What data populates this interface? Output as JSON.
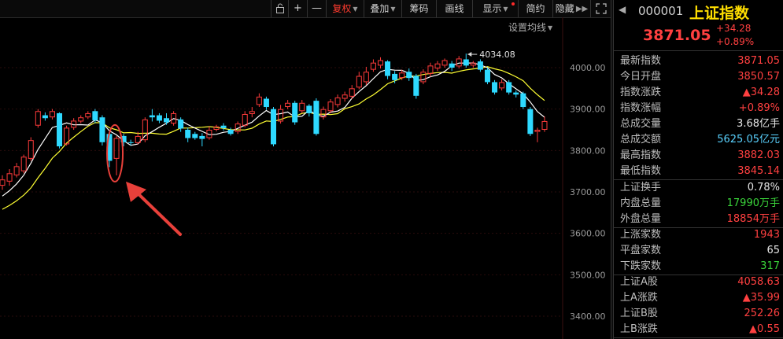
{
  "toolbar": {
    "lock_icon": "lock-icon",
    "plus": "+",
    "minus": "—",
    "items": [
      "复权",
      "叠加",
      "筹码",
      "画线",
      "显示",
      "简约",
      "隐藏"
    ],
    "active_color": "#ff3b2f",
    "ma_setting": "设置均线"
  },
  "panel": {
    "code": "000001",
    "name": "上证指数",
    "price": "3871.05",
    "change": "+34.28",
    "change_pct": "+0.89%",
    "group1": [
      {
        "label": "最新指数",
        "value": "3871.05",
        "color": "red"
      },
      {
        "label": "今日开盘",
        "value": "3850.57",
        "color": "red"
      },
      {
        "label": "指数涨跌",
        "value": "▲34.28",
        "color": "red"
      },
      {
        "label": "指数涨幅",
        "value": "+0.89%",
        "color": "red"
      },
      {
        "label": "总成交量",
        "value": "3.68亿手",
        "color": "white"
      },
      {
        "label": "总成交额",
        "value": "5625.05亿元",
        "color": "cyan"
      },
      {
        "label": "最高指数",
        "value": "3882.03",
        "color": "red"
      },
      {
        "label": "最低指数",
        "value": "3845.14",
        "color": "red"
      }
    ],
    "group2": [
      {
        "label": "上证换手",
        "value": "0.78%",
        "color": "white"
      },
      {
        "label": "内盘总量",
        "value": "17990万手",
        "color": "green"
      },
      {
        "label": "外盘总量",
        "value": "18854万手",
        "color": "red"
      }
    ],
    "group3": [
      {
        "label": "上涨家数",
        "value": "1943",
        "color": "red"
      },
      {
        "label": "平盘家数",
        "value": "65",
        "color": "white"
      },
      {
        "label": "下跌家数",
        "value": "317",
        "color": "green"
      }
    ],
    "group4": [
      {
        "label": "上证A股",
        "value": "4058.63",
        "color": "red"
      },
      {
        "label": "上A涨跌",
        "value": "▲35.99",
        "color": "red"
      },
      {
        "label": "上证B股",
        "value": "252.26",
        "color": "red"
      },
      {
        "label": "上B涨跌",
        "value": "▲0.55",
        "color": "red"
      }
    ]
  },
  "chart_data": {
    "type": "candlestick",
    "ylim": [
      3350,
      4100
    ],
    "yticks": [
      "4000.00",
      "3900.00",
      "3800.00",
      "3700.00",
      "3600.00",
      "3500.00",
      "3400.00"
    ],
    "ytick_values": [
      4000,
      3900,
      3800,
      3700,
      3600,
      3500,
      3400
    ],
    "max_label": "4034.08",
    "max_value": 4034.08,
    "up_color": "#ff3b3b",
    "down_color": "#2ed9ff",
    "ma5_color": "#ffffff",
    "ma10_color": "#ffff33",
    "candles": [
      {
        "o": 3715,
        "c": 3730,
        "h": 3740,
        "l": 3705
      },
      {
        "o": 3725,
        "c": 3745,
        "h": 3755,
        "l": 3715
      },
      {
        "o": 3740,
        "c": 3762,
        "h": 3770,
        "l": 3735
      },
      {
        "o": 3750,
        "c": 3785,
        "h": 3790,
        "l": 3745
      },
      {
        "o": 3780,
        "c": 3825,
        "h": 3832,
        "l": 3775
      },
      {
        "o": 3860,
        "c": 3895,
        "h": 3900,
        "l": 3855
      },
      {
        "o": 3885,
        "c": 3878,
        "h": 3892,
        "l": 3872
      },
      {
        "o": 3880,
        "c": 3895,
        "h": 3900,
        "l": 3875
      },
      {
        "o": 3890,
        "c": 3810,
        "h": 3892,
        "l": 3805
      },
      {
        "o": 3815,
        "c": 3855,
        "h": 3860,
        "l": 3812
      },
      {
        "o": 3855,
        "c": 3872,
        "h": 3878,
        "l": 3850
      },
      {
        "o": 3870,
        "c": 3880,
        "h": 3885,
        "l": 3866
      },
      {
        "o": 3880,
        "c": 3890,
        "h": 3895,
        "l": 3876
      },
      {
        "o": 3895,
        "c": 3873,
        "h": 3900,
        "l": 3866
      },
      {
        "o": 3880,
        "c": 3820,
        "h": 3885,
        "l": 3812
      },
      {
        "o": 3840,
        "c": 3775,
        "h": 3845,
        "l": 3760
      },
      {
        "o": 3780,
        "c": 3830,
        "h": 3835,
        "l": 3740
      },
      {
        "o": 3835,
        "c": 3820,
        "h": 3840,
        "l": 3810
      },
      {
        "o": 3820,
        "c": 3818,
        "h": 3826,
        "l": 3812
      },
      {
        "o": 3818,
        "c": 3835,
        "h": 3845,
        "l": 3815
      },
      {
        "o": 3825,
        "c": 3875,
        "h": 3880,
        "l": 3820
      },
      {
        "o": 3885,
        "c": 3880,
        "h": 3900,
        "l": 3870
      },
      {
        "o": 3885,
        "c": 3872,
        "h": 3890,
        "l": 3866
      },
      {
        "o": 3878,
        "c": 3868,
        "h": 3890,
        "l": 3862
      },
      {
        "o": 3865,
        "c": 3890,
        "h": 3895,
        "l": 3860
      },
      {
        "o": 3875,
        "c": 3853,
        "h": 3880,
        "l": 3845
      },
      {
        "o": 3850,
        "c": 3830,
        "h": 3855,
        "l": 3820
      },
      {
        "o": 3840,
        "c": 3830,
        "h": 3845,
        "l": 3826
      },
      {
        "o": 3835,
        "c": 3828,
        "h": 3842,
        "l": 3810
      },
      {
        "o": 3830,
        "c": 3850,
        "h": 3858,
        "l": 3826
      },
      {
        "o": 3850,
        "c": 3858,
        "h": 3862,
        "l": 3846
      },
      {
        "o": 3860,
        "c": 3854,
        "h": 3866,
        "l": 3848
      },
      {
        "o": 3850,
        "c": 3840,
        "h": 3855,
        "l": 3836
      },
      {
        "o": 3845,
        "c": 3865,
        "h": 3870,
        "l": 3840
      },
      {
        "o": 3860,
        "c": 3888,
        "h": 3895,
        "l": 3856
      },
      {
        "o": 3888,
        "c": 3895,
        "h": 3905,
        "l": 3880
      },
      {
        "o": 3910,
        "c": 3930,
        "h": 3938,
        "l": 3905
      },
      {
        "o": 3925,
        "c": 3905,
        "h": 3930,
        "l": 3898
      },
      {
        "o": 3900,
        "c": 3815,
        "h": 3905,
        "l": 3810
      },
      {
        "o": 3870,
        "c": 3900,
        "h": 3910,
        "l": 3865
      },
      {
        "o": 3905,
        "c": 3915,
        "h": 3922,
        "l": 3900
      },
      {
        "o": 3915,
        "c": 3868,
        "h": 3920,
        "l": 3862
      },
      {
        "o": 3895,
        "c": 3915,
        "h": 3922,
        "l": 3890
      },
      {
        "o": 3908,
        "c": 3890,
        "h": 3912,
        "l": 3882
      },
      {
        "o": 3920,
        "c": 3840,
        "h": 3926,
        "l": 3836
      },
      {
        "o": 3880,
        "c": 3900,
        "h": 3906,
        "l": 3875
      },
      {
        "o": 3895,
        "c": 3918,
        "h": 3924,
        "l": 3890
      },
      {
        "o": 3910,
        "c": 3928,
        "h": 3935,
        "l": 3904
      },
      {
        "o": 3925,
        "c": 3935,
        "h": 3942,
        "l": 3918
      },
      {
        "o": 3930,
        "c": 3950,
        "h": 3958,
        "l": 3924
      },
      {
        "o": 3952,
        "c": 3980,
        "h": 3990,
        "l": 3948
      },
      {
        "o": 3965,
        "c": 3990,
        "h": 4002,
        "l": 3958
      },
      {
        "o": 3995,
        "c": 4012,
        "h": 4020,
        "l": 3990
      },
      {
        "o": 4005,
        "c": 4018,
        "h": 4025,
        "l": 3998
      },
      {
        "o": 4015,
        "c": 3980,
        "h": 4018,
        "l": 3972
      },
      {
        "o": 3985,
        "c": 3970,
        "h": 3992,
        "l": 3962
      },
      {
        "o": 3975,
        "c": 3988,
        "h": 3995,
        "l": 3970
      },
      {
        "o": 3990,
        "c": 3975,
        "h": 3998,
        "l": 3968
      },
      {
        "o": 3980,
        "c": 3932,
        "h": 3985,
        "l": 3925
      },
      {
        "o": 3965,
        "c": 3990,
        "h": 3996,
        "l": 3960
      },
      {
        "o": 3985,
        "c": 4005,
        "h": 4012,
        "l": 3978
      },
      {
        "o": 3998,
        "c": 4010,
        "h": 4016,
        "l": 3992
      },
      {
        "o": 4005,
        "c": 4018,
        "h": 4022,
        "l": 4000
      },
      {
        "o": 4010,
        "c": 4000,
        "h": 4016,
        "l": 3992
      },
      {
        "o": 4003,
        "c": 4022,
        "h": 4028,
        "l": 3998
      },
      {
        "o": 4020,
        "c": 4005,
        "h": 4034,
        "l": 4000
      },
      {
        "o": 4005,
        "c": 4012,
        "h": 4016,
        "l": 4000
      },
      {
        "o": 4015,
        "c": 3995,
        "h": 4020,
        "l": 3990
      },
      {
        "o": 3995,
        "c": 3965,
        "h": 4000,
        "l": 3960
      },
      {
        "o": 3965,
        "c": 3940,
        "h": 3970,
        "l": 3935
      },
      {
        "o": 3950,
        "c": 3965,
        "h": 3972,
        "l": 3945
      },
      {
        "o": 3965,
        "c": 3940,
        "h": 3970,
        "l": 3935
      },
      {
        "o": 3940,
        "c": 3935,
        "h": 3945,
        "l": 3928
      },
      {
        "o": 3938,
        "c": 3905,
        "h": 3942,
        "l": 3900
      },
      {
        "o": 3900,
        "c": 3840,
        "h": 3905,
        "l": 3835
      },
      {
        "o": 3845,
        "c": 3850,
        "h": 3855,
        "l": 3820
      },
      {
        "o": 3850,
        "c": 3871,
        "h": 3882,
        "l": 3845
      }
    ],
    "annotation": {
      "candle_index": 16,
      "shape": "ellipse-with-arrow",
      "color": "#e8403a"
    }
  }
}
